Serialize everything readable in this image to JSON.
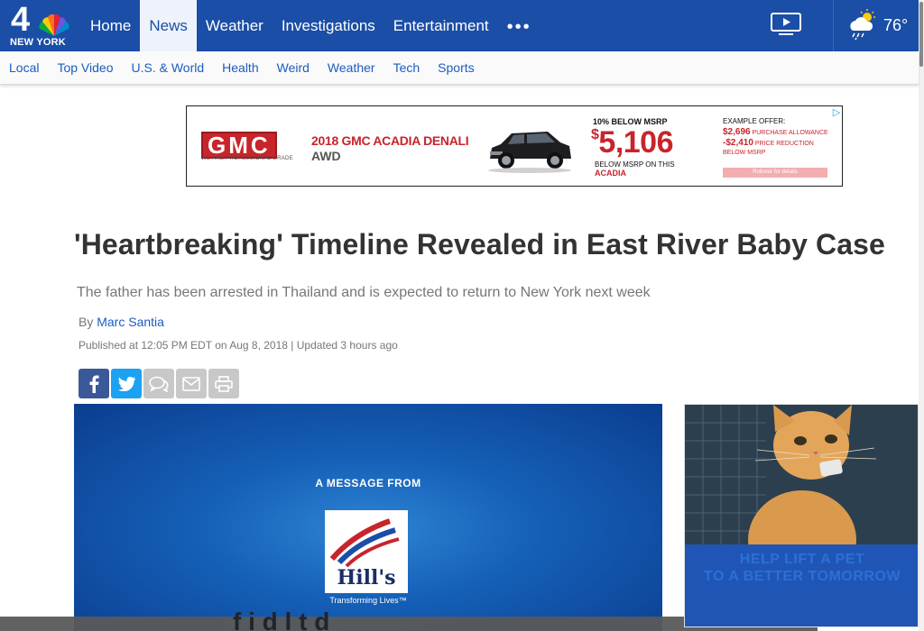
{
  "brand": {
    "logo_number": "4",
    "logo_city": "NEW YORK"
  },
  "nav": {
    "items": [
      {
        "label": "Home"
      },
      {
        "label": "News",
        "active": true
      },
      {
        "label": "Weather"
      },
      {
        "label": "Investigations"
      },
      {
        "label": "Entertainment"
      }
    ],
    "more_label": "•••",
    "temperature": "76°",
    "colors": {
      "nav_bg": "#1b4ea6",
      "link": "#1b5cc0"
    }
  },
  "subnav": {
    "items": [
      "Local",
      "Top Video",
      "U.S. & World",
      "Health",
      "Weird",
      "Weather",
      "Tech",
      "Sports"
    ]
  },
  "ad": {
    "brand": "GMC",
    "brand_tagline": "WE ARE PROFESSIONAL GRADE",
    "model": "2018 GMC ACADIA DENALI",
    "trim": "AWD",
    "pct_below": "10% BELOW MSRP",
    "price_currency": "$",
    "price_amount": "5,106",
    "below_msrp_text": "BELOW MSRP ON THIS",
    "below_msrp_model": "ACADIA",
    "example_label": "EXAMPLE OFFER:",
    "offer1_amount": "$2,696",
    "offer1_text": "PURCHASE ALLOWANCE",
    "offer2_amount": "-$2,410",
    "offer2_text": "PRICE REDUCTION BELOW MSRP",
    "rollover": "Rollover for details",
    "adchoice": "▷"
  },
  "article": {
    "headline": "'Heartbreaking' Timeline Revealed in East River Baby Case",
    "subhead": "The father has been arrested in Thailand and is expected to return to New York next week",
    "byline_prefix": "By ",
    "author": "Marc Santia",
    "published": "Published at 12:05 PM EDT on Aug 8, 2018 | Updated 3 hours ago"
  },
  "video": {
    "message_from": "A MESSAGE FROM",
    "sponsor_logo_text": "Hill's",
    "tagline": "Transforming Lives™",
    "caption_fragment": "f      i   d   l  t     d"
  },
  "side_video": {
    "overlay_text": "HELP LIFT A PET\nTO A BETTER TOMORROW"
  }
}
